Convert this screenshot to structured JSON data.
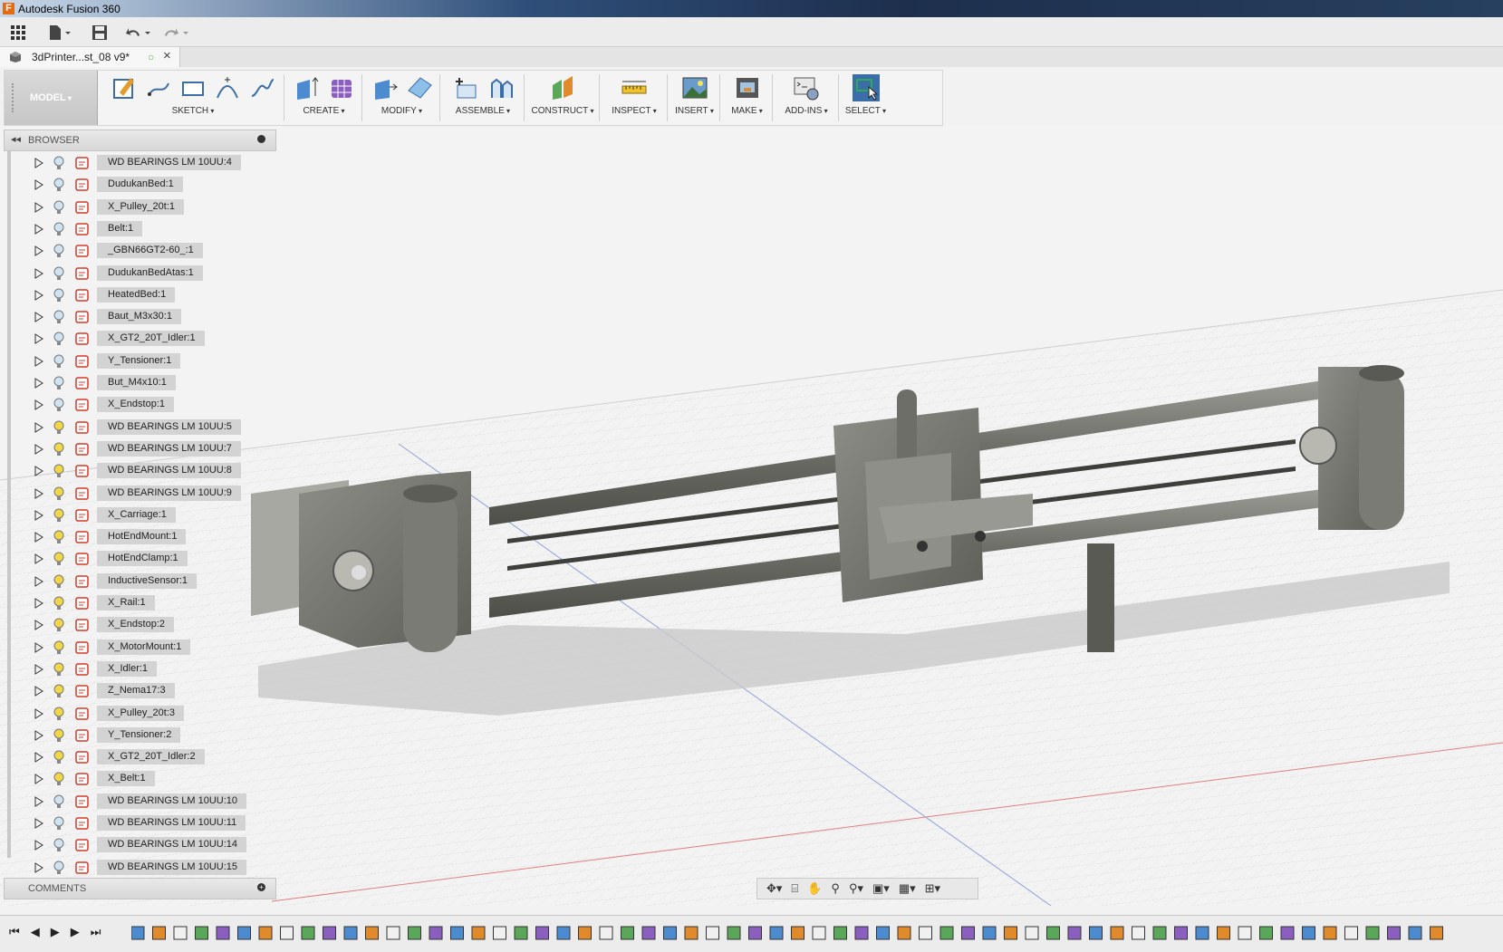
{
  "titlebar": {
    "title": "Autodesk Fusion 360",
    "app_glyph": "F"
  },
  "document": {
    "tab_name": "3dPrinter...st_08 v9*"
  },
  "toolbar": {
    "workspace": "MODEL",
    "groups": [
      "SKETCH",
      "CREATE",
      "MODIFY",
      "ASSEMBLE",
      "CONSTRUCT",
      "INSPECT",
      "INSERT",
      "MAKE",
      "ADD-INS",
      "SELECT"
    ]
  },
  "browser": {
    "title": "BROWSER",
    "items": [
      {
        "name": "WD BEARINGS LM 10UU:4",
        "visible": false
      },
      {
        "name": "DudukanBed:1",
        "visible": false
      },
      {
        "name": "X_Pulley_20t:1",
        "visible": false
      },
      {
        "name": "Belt:1",
        "visible": false
      },
      {
        "name": "_GBN66GT2-60_:1",
        "visible": false
      },
      {
        "name": "DudukanBedAtas:1",
        "visible": false
      },
      {
        "name": "HeatedBed:1",
        "visible": false
      },
      {
        "name": "Baut_M3x30:1",
        "visible": false
      },
      {
        "name": "X_GT2_20T_Idler:1",
        "visible": false
      },
      {
        "name": "Y_Tensioner:1",
        "visible": false
      },
      {
        "name": "But_M4x10:1",
        "visible": false
      },
      {
        "name": "X_Endstop:1",
        "visible": false
      },
      {
        "name": "WD BEARINGS LM 10UU:5",
        "visible": true
      },
      {
        "name": "WD BEARINGS LM 10UU:7",
        "visible": true
      },
      {
        "name": "WD BEARINGS LM 10UU:8",
        "visible": true
      },
      {
        "name": "WD BEARINGS LM 10UU:9",
        "visible": true
      },
      {
        "name": "X_Carriage:1",
        "visible": true
      },
      {
        "name": "HotEndMount:1",
        "visible": true
      },
      {
        "name": "HotEndClamp:1",
        "visible": true
      },
      {
        "name": "InductiveSensor:1",
        "visible": true
      },
      {
        "name": "X_Rail:1",
        "visible": true
      },
      {
        "name": "X_Endstop:2",
        "visible": true
      },
      {
        "name": "X_MotorMount:1",
        "visible": true
      },
      {
        "name": "X_Idler:1",
        "visible": true
      },
      {
        "name": "Z_Nema17:3",
        "visible": true
      },
      {
        "name": "X_Pulley_20t:3",
        "visible": true
      },
      {
        "name": "Y_Tensioner:2",
        "visible": true
      },
      {
        "name": "X_GT2_20T_Idler:2",
        "visible": true
      },
      {
        "name": "X_Belt:1",
        "visible": true
      },
      {
        "name": "WD BEARINGS LM 10UU:10",
        "visible": false
      },
      {
        "name": "WD BEARINGS LM 10UU:11",
        "visible": false
      },
      {
        "name": "WD BEARINGS LM 10UU:14",
        "visible": false
      },
      {
        "name": "WD BEARINGS LM 10UU:15",
        "visible": false
      }
    ]
  },
  "comments": {
    "title": "COMMENTS"
  },
  "colors": {
    "accent": "#3b6ea8",
    "bulb_on": "#f0d74a",
    "bulb_off": "#cfe4f3",
    "component_red": "#d23b2b",
    "model_gray": "#7a7a74"
  },
  "icons": {
    "nav": [
      "orbit-icon",
      "look-at-icon",
      "pan-icon",
      "zoom-icon",
      "fit-icon",
      "display-settings-icon",
      "grid-icon",
      "viewports-icon"
    ],
    "timeline_controls": [
      "first-icon",
      "previous-icon",
      "play-icon",
      "next-icon",
      "last-icon"
    ]
  }
}
